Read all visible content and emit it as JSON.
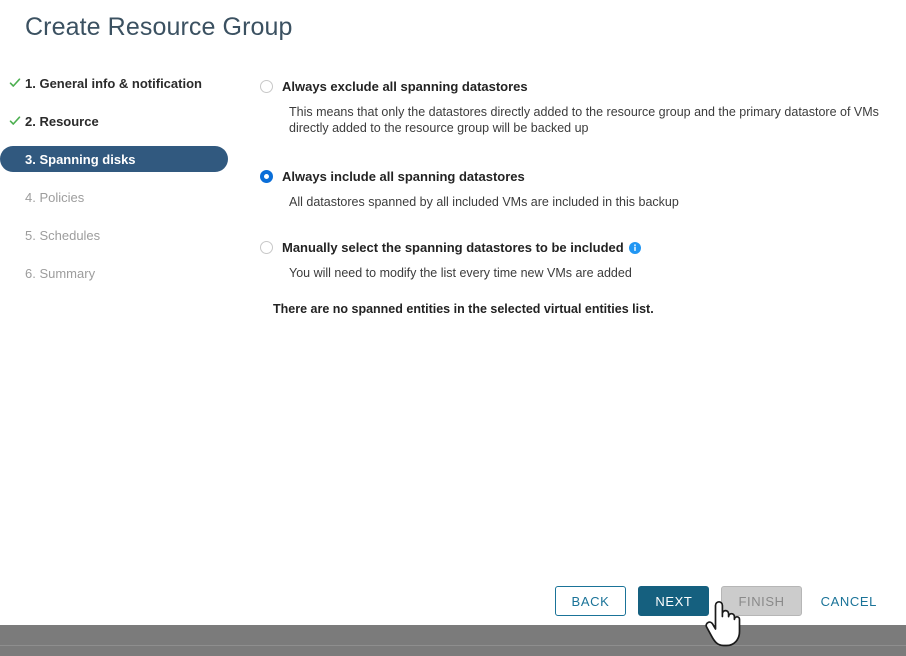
{
  "window": {
    "title": "Create Resource Group"
  },
  "sidebar": {
    "steps": [
      {
        "label": "1. General info & notification",
        "state": "done",
        "icon": "check-icon"
      },
      {
        "label": "2. Resource",
        "state": "done",
        "icon": "check-icon"
      },
      {
        "label": "3. Spanning disks",
        "state": "active",
        "icon": ""
      },
      {
        "label": "4. Policies",
        "state": "disabled",
        "icon": ""
      },
      {
        "label": "5. Schedules",
        "state": "disabled",
        "icon": ""
      },
      {
        "label": "6. Summary",
        "state": "disabled",
        "icon": ""
      }
    ]
  },
  "main": {
    "options": [
      {
        "label": "Always exclude all spanning datastores",
        "selected": false,
        "description": "This means that only the datastores directly added to the resource group and the primary datastore of VMs directly added to the resource group will be backed up",
        "info_icon": ""
      },
      {
        "label": "Always include all spanning datastores",
        "selected": true,
        "description": "All datastores spanned by all included VMs are included in this backup",
        "info_icon": ""
      },
      {
        "label": "Manually select the spanning datastores to be included",
        "selected": false,
        "description": "You will need to modify the list every time new VMs are added",
        "info_icon": "info-icon"
      }
    ],
    "notice": "There are no spanned entities in the selected virtual entities list."
  },
  "footer": {
    "back_label": "BACK",
    "next_label": "NEXT",
    "finish_label": "FINISH",
    "cancel_label": "CANCEL"
  },
  "colors": {
    "accent_teal": "#15607f",
    "link_teal": "#1a7398",
    "active_step": "#31597f",
    "radio_selected": "#0a6ed8",
    "check_green": "#4caf50",
    "info_blue": "#2196f3",
    "bottom_bar": "#7b7b7b"
  }
}
